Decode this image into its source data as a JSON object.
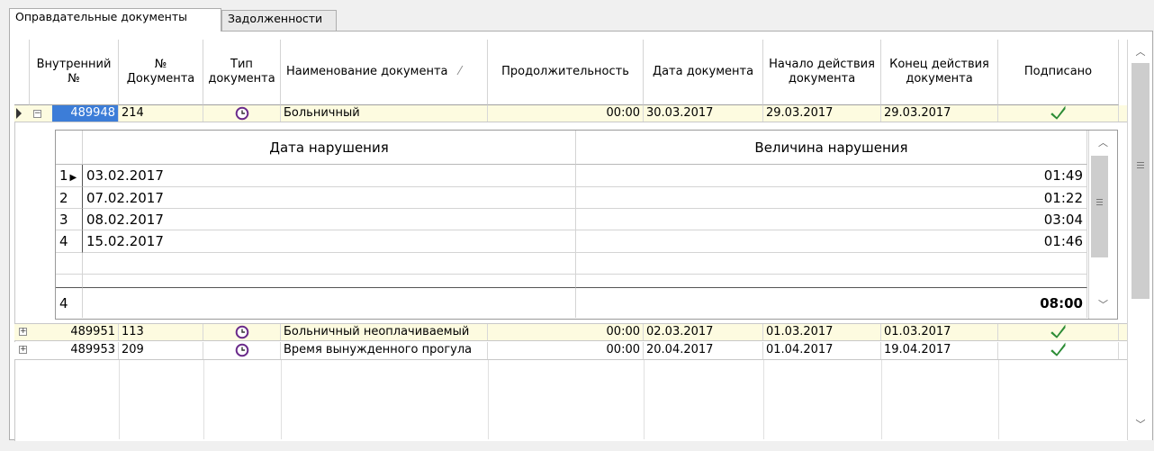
{
  "tabs": [
    {
      "label": "Оправдательные документы",
      "active": true
    },
    {
      "label": "Задолженности",
      "active": false
    }
  ],
  "grid": {
    "columns": [
      "Внутренний №",
      "№ Документа",
      "Тип документа",
      "Наименование документа",
      "Продолжительность",
      "Дата документа",
      "Начало действия документа",
      "Конец действия документа",
      "Подписано"
    ],
    "sort_indicator": "⁄",
    "rows": [
      {
        "id": "489948",
        "doc_no": "214",
        "type_icon": "clock-icon",
        "name": "Больничный",
        "duration": "00:00",
        "doc_date": "30.03.2017",
        "start": "29.03.2017",
        "end": "29.03.2017",
        "signed": true,
        "expanded": true
      },
      {
        "id": "489951",
        "doc_no": "113",
        "type_icon": "clock-icon",
        "name": "Больничный неоплачиваемый",
        "duration": "00:00",
        "doc_date": "02.03.2017",
        "start": "01.03.2017",
        "end": "01.03.2017",
        "signed": true,
        "expanded": false
      },
      {
        "id": "489953",
        "doc_no": "209",
        "type_icon": "clock-icon",
        "name": "Время вынужденного прогула",
        "duration": "00:00",
        "doc_date": "20.04.2017",
        "start": "01.04.2017",
        "end": "19.04.2017",
        "signed": true,
        "expanded": false
      }
    ]
  },
  "detail": {
    "columns": [
      "Дата нарушения",
      "Величина нарушения"
    ],
    "rows": [
      {
        "n": "1",
        "date": "03.02.2017",
        "value": "01:49"
      },
      {
        "n": "2",
        "date": "07.02.2017",
        "value": "01:22"
      },
      {
        "n": "3",
        "date": "08.02.2017",
        "value": "03:04"
      },
      {
        "n": "4",
        "date": "15.02.2017",
        "value": "01:46"
      }
    ],
    "footer": {
      "count": "4",
      "total": "08:00"
    }
  },
  "colors": {
    "selected_id_bg": "#3c7dd8",
    "highlight_row": "#fdfbe0",
    "signed_check": "#3cb043",
    "clock": "#6a2a8a"
  }
}
